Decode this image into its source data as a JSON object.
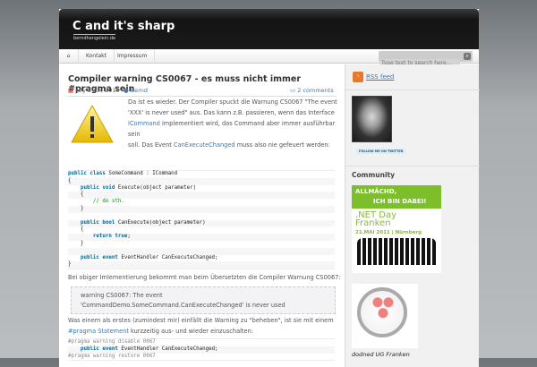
{
  "header": {
    "title": "C and it's sharp",
    "subtitle": "berndhengelein.de"
  },
  "nav": {
    "items": [
      "Kontakt",
      "Impressum"
    ],
    "search_placeholder": "Type text to search here..."
  },
  "post": {
    "title": "Compiler warning CS0067 - es muss nicht immer #pragma sein",
    "date": "July 29th, 2010",
    "author": "Bernd",
    "comments": "2 comments",
    "intro": [
      "Da ist es wieder. Der Compiler spuckt die Warnung CS0067 \"The event",
      "'XXX' is never used\" aus. Das kann z.B. passieren, wenn das Interface"
    ],
    "intro_link1": "ICommand",
    "intro_3b": " implementiert wird, das Command aber immer ausführbar sein",
    "intro_4a": "soll. Das Event ",
    "intro_link2": "CanExecuteChanged",
    "intro_4b": " muss also nie gefeuert werden:",
    "code1": [
      [
        "kw",
        "public class",
        " SomeCommand : ICommand"
      ],
      [
        "",
        "",
        "{"
      ],
      [
        "kw",
        "    public void",
        " Execute(object parameter)"
      ],
      [
        "",
        "",
        "    {"
      ],
      [
        "cm",
        "",
        "        // do sth."
      ],
      [
        "",
        "",
        "    }"
      ],
      [
        "",
        "",
        ""
      ],
      [
        "kw",
        "    public bool",
        " CanExecute(object parameter)"
      ],
      [
        "",
        "",
        "    {"
      ],
      [
        "kw",
        "        return true",
        ";"
      ],
      [
        "",
        "",
        "    }"
      ],
      [
        "",
        "",
        ""
      ],
      [
        "kw",
        "    public event",
        " EventHandler CanExecuteChanged;"
      ],
      [
        "",
        "",
        "}"
      ]
    ],
    "para2": "Bei obiger Imlementierung bekommt man beim Übersetzten die Compiler Warnung CS0067:",
    "quote": "warning CS0067: The event 'CommandDemo.SomeCommand.CanExecuteChanged' is never used",
    "para3a": "Was einem als erstes (zumindest mir) einfällt die Warning zu \"beheben\", ist sie mit einem",
    "para3_link": "#pragma Statement",
    "para3b": " kurzzeitig aus- und wieder einzuschalten:",
    "code2": [
      "#pragma warning disable 0067",
      "public event",
      "EventHandler CanExecuteChanged;",
      "#pragma warning restore 0067"
    ]
  },
  "sidebar": {
    "rss": "RSS feed",
    "twitter": "FOLLOW ME ON TWITTER",
    "community": "Community",
    "banner1": "ALLMÄCHD,",
    "banner2": "ICH BIN DABEI!",
    "banner3": ".NET Day",
    "banner4": "Franken",
    "banner5": "21.MAI 2011 | Nürnberg",
    "dodned": "dodned UG Franken"
  }
}
